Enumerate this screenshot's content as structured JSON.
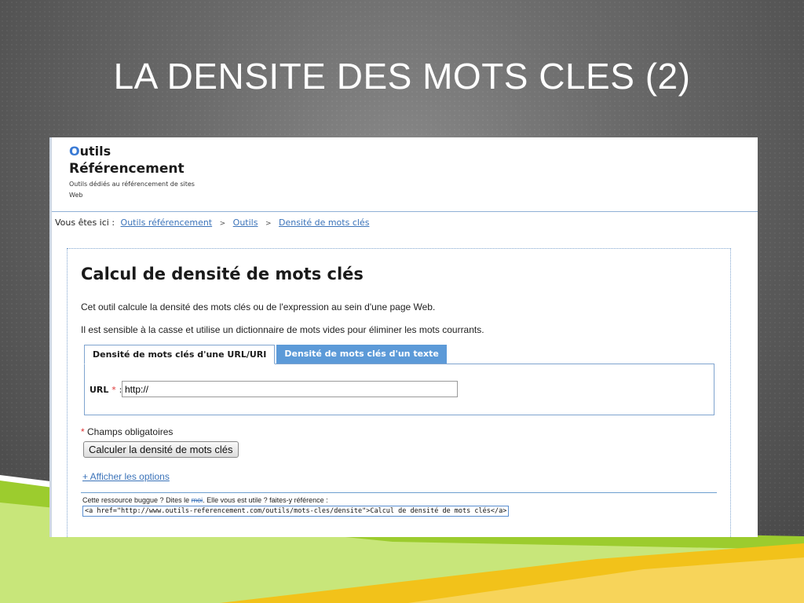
{
  "slide": {
    "title": "LA DENSITE DES MOTS CLES (2)"
  },
  "site": {
    "logo_first_letter": "O",
    "logo_rest": "utils",
    "logo_line2": "Référencement",
    "tagline": "Outils dédiés au référencement de sites Web"
  },
  "breadcrumb": {
    "prefix": "Vous êtes ici :",
    "items": [
      "Outils référencement",
      "Outils",
      "Densité de mots clés"
    ],
    "separator": ">"
  },
  "page": {
    "heading": "Calcul de densité de mots clés",
    "desc1": "Cet outil calcule la densité des mots clés ou de l'expression au sein d'une page Web.",
    "desc2": "Il est sensible à la casse et utilise un dictionnaire de mots vides pour éliminer les mots courrants."
  },
  "tabs": [
    {
      "label": "Densité de mots clés d'une URL/URI",
      "active": true
    },
    {
      "label": "Densité de mots clés d'un texte",
      "active": false
    }
  ],
  "form": {
    "url_label": "URL",
    "required_mark": "*",
    "colon": ":",
    "url_value": "http://",
    "required_note": "Champs obligatoires",
    "submit_label": "Calculer la densité de mots clés",
    "options_link": "+ Afficher les options"
  },
  "footer": {
    "text_before": "Cette ressource buggue ? Dites le",
    "link": "moi",
    "text_after": ". Elle vous est utile ? faites-y référence :",
    "code": "<a href=\"http://www.outils-referencement.com/outils/mots-cles/densite\">Calcul de densité de mots clés</a>"
  },
  "colors": {
    "accent_blue": "#5c9ad8",
    "link_blue": "#3b73b9",
    "green_band": "#9ccc2e",
    "yellow_band": "#f2c21a"
  }
}
